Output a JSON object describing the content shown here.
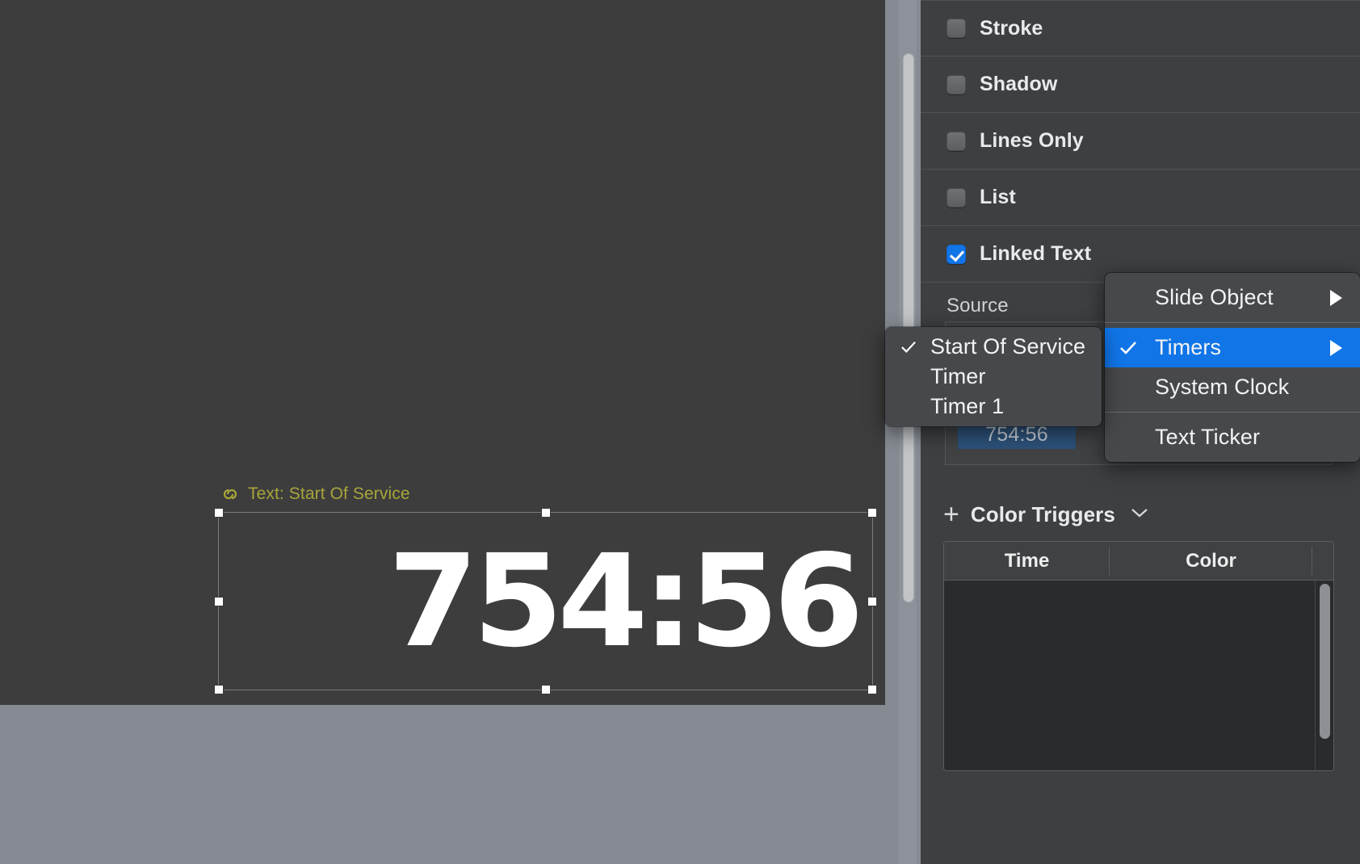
{
  "canvas": {
    "object_label": "Text: Start Of Service",
    "link_icon": "link-chain-icon",
    "timer_text": "754:56"
  },
  "inspector": {
    "checkboxes": [
      {
        "label": "Stroke",
        "checked": false
      },
      {
        "label": "Shadow",
        "checked": false
      },
      {
        "label": "Lines Only",
        "checked": false
      },
      {
        "label": "List",
        "checked": false
      },
      {
        "label": "Linked Text",
        "checked": true
      }
    ],
    "source": {
      "label": "Source",
      "selected_value": "754:56"
    },
    "color_triggers": {
      "plus": "+",
      "title": "Color Triggers",
      "chevron": "chevron-down-icon",
      "columns": [
        "Time",
        "Color"
      ],
      "rows": []
    }
  },
  "menus": {
    "source_menu": {
      "items": [
        {
          "label": "Slide Object",
          "checked": false,
          "submenu": true,
          "selected": false,
          "separator_after": true
        },
        {
          "label": "Timers",
          "checked": true,
          "submenu": true,
          "selected": true,
          "separator_after": false
        },
        {
          "label": "System Clock",
          "checked": false,
          "submenu": false,
          "selected": false,
          "separator_after": true
        },
        {
          "label": "Text Ticker",
          "checked": false,
          "submenu": false,
          "selected": false,
          "separator_after": false
        }
      ]
    },
    "timers_menu": {
      "items": [
        {
          "label": "Start Of Service",
          "checked": true
        },
        {
          "label": "Timer",
          "checked": false
        },
        {
          "label": "Timer 1",
          "checked": false
        }
      ]
    }
  },
  "colors": {
    "accent_blue": "#1175e8",
    "canvas_bg": "#3d3d3d",
    "panel_bg": "#3d3f41",
    "label_yellow": "#a8a53a",
    "selection_blue": "#2d5179",
    "window_gray": "#868b93"
  }
}
